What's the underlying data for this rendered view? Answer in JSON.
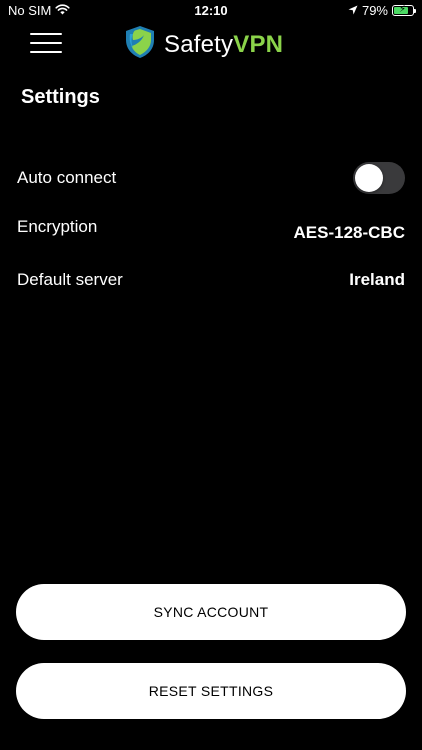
{
  "status_bar": {
    "carrier": "No SIM",
    "time": "12:10",
    "battery_percent": "79%",
    "battery_level": 0.79
  },
  "header": {
    "logo_text_a": "Safety",
    "logo_text_b": "VPN",
    "brand_color": "#8bd34a"
  },
  "page": {
    "title": "Settings"
  },
  "settings": {
    "auto_connect": {
      "label": "Auto connect",
      "enabled": false
    },
    "encryption": {
      "label": "Encryption",
      "value": "AES-128-CBC"
    },
    "default_server": {
      "label": "Default server",
      "value": "Ireland"
    }
  },
  "buttons": {
    "sync": "SYNC ACCOUNT",
    "reset": "RESET SETTINGS"
  },
  "icons": {
    "wifi": "wifi-icon",
    "location": "location-arrow-icon",
    "battery": "battery-icon",
    "menu": "hamburger-menu-icon",
    "logo": "shield-logo-icon"
  }
}
